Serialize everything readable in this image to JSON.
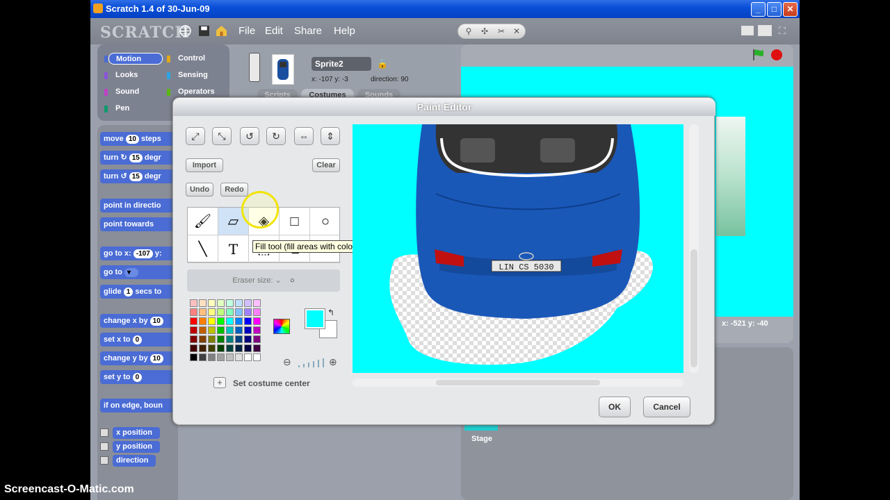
{
  "window": {
    "title": "Scratch 1.4 of 30-Jun-09",
    "min": "_",
    "max": "□",
    "close": "✕"
  },
  "menubar": {
    "logo": "SCRATCH",
    "file": "File",
    "edit": "Edit",
    "share": "Share",
    "help": "Help"
  },
  "categories": [
    "Motion",
    "Control",
    "Looks",
    "Sensing",
    "Sound",
    "Operators",
    "Pen"
  ],
  "category_colors": [
    "#4a6cd4",
    "#e1a91a",
    "#8a55d7",
    "#2ca5e2",
    "#bb42c3",
    "#5cb712",
    "#0e9a6c"
  ],
  "blocks": {
    "move": "move",
    "move_val": "10",
    "move_suffix": "steps",
    "turn_cw": "turn ↻",
    "turn_cw_val": "15",
    "turn_cw_suffix": "degr",
    "turn_ccw": "turn ↺",
    "turn_ccw_val": "15",
    "turn_ccw_suffix": "degr",
    "point_dir": "point in directio",
    "point_towards": "point towards",
    "goto_xy": "go to x:",
    "goto_x_val": "-107",
    "goto_y": "y:",
    "goto": "go to",
    "glide": "glide",
    "glide_val": "1",
    "glide_suffix": "secs to",
    "change_x": "change x by",
    "change_x_val": "10",
    "set_x": "set x to",
    "set_x_val": "0",
    "change_y": "change y by",
    "change_y_val": "10",
    "set_y": "set y to",
    "set_y_val": "0",
    "bounce": "if on edge, boun",
    "xpos": "x position",
    "ypos": "y position",
    "direction": "direction"
  },
  "sprite": {
    "name": "Sprite2",
    "coords": "x: -107  y: -3",
    "direction": "direction: 90"
  },
  "tabs": {
    "scripts": "Scripts",
    "costumes": "Costumes",
    "sounds": "Sounds"
  },
  "stage": {
    "coords": "x: -521   y: -40",
    "label": "Stage"
  },
  "paint_editor": {
    "title": "Paint Editor",
    "import": "Import",
    "clear": "Clear",
    "undo": "Undo",
    "redo": "Redo",
    "tooltip": "Fill tool (fill areas with color or gradient)",
    "eraser_size": "Eraser size:",
    "set_center": "Set costume center",
    "ok": "OK",
    "cancel": "Cancel",
    "plate": "LIN CS 5030"
  },
  "palette_colors": [
    "#ffc0c0",
    "#ffe0c0",
    "#ffffc0",
    "#e0ffc0",
    "#c0ffe0",
    "#c0e0ff",
    "#d0c0ff",
    "#ffc0ff",
    "#ff8080",
    "#ffc080",
    "#ffff80",
    "#c0ff80",
    "#80ffc0",
    "#80c0ff",
    "#a080ff",
    "#ff80ff",
    "#ff0000",
    "#ff8000",
    "#ffff00",
    "#00ff00",
    "#00ffff",
    "#0080ff",
    "#0000ff",
    "#ff00ff",
    "#c00000",
    "#c06000",
    "#c0c000",
    "#00c000",
    "#00c0c0",
    "#0060c0",
    "#0000c0",
    "#c000c0",
    "#800000",
    "#804000",
    "#808000",
    "#008000",
    "#008080",
    "#004080",
    "#000080",
    "#800080",
    "#400000",
    "#402000",
    "#404000",
    "#004000",
    "#004040",
    "#002040",
    "#000040",
    "#400040",
    "#000000",
    "#404040",
    "#808080",
    "#a0a0a0",
    "#c0c0c0",
    "#e0e0e0",
    "#ffffff",
    "#ffffff"
  ],
  "accent": "#00ffff",
  "watermark": "Screencast-O-Matic.com"
}
